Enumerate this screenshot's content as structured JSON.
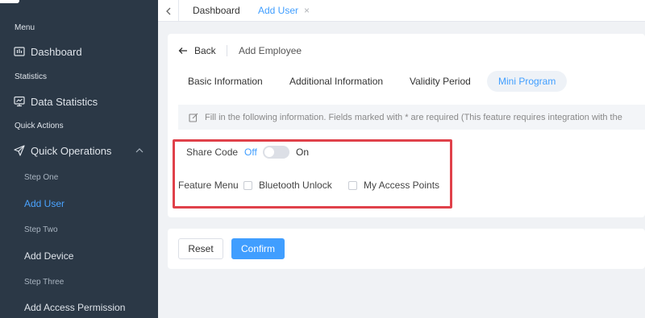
{
  "sidebar": {
    "sections": {
      "menu": "Menu",
      "statistics": "Statistics",
      "quick_actions": "Quick Actions"
    },
    "items": {
      "dashboard": "Dashboard",
      "data_statistics": "Data Statistics",
      "quick_operations": "Quick Operations"
    },
    "sub_items": {
      "step_one": "Step One",
      "add_user": "Add User",
      "step_two": "Step Two",
      "add_device": "Add Device",
      "step_three": "Step Three",
      "add_access_permission": "Add Access Permission"
    }
  },
  "tabbar": {
    "tabs": [
      "Dashboard",
      "Add User"
    ],
    "active_tab": "Add User",
    "close_icon": "×"
  },
  "page": {
    "back_label": "Back",
    "title": "Add Employee",
    "tabs": [
      "Basic Information",
      "Additional Information",
      "Validity Period",
      "Mini Program"
    ],
    "active_tab": "Mini Program",
    "tip": "Fill in the following information. Fields marked with * are required (This feature requires integration with the"
  },
  "form": {
    "share_code": {
      "label": "Share Code",
      "off_label": "Off",
      "on_label": "On",
      "enabled": false
    },
    "feature_menu": {
      "label": "Feature Menu",
      "options": [
        {
          "label": "Bluetooth Unlock",
          "checked": false
        },
        {
          "label": "My Access Points",
          "checked": false
        }
      ]
    }
  },
  "actions": {
    "reset": "Reset",
    "confirm": "Confirm"
  },
  "colors": {
    "sidebar_bg": "#2b3846",
    "accent": "#409eff",
    "highlight_border": "#e0414a"
  }
}
